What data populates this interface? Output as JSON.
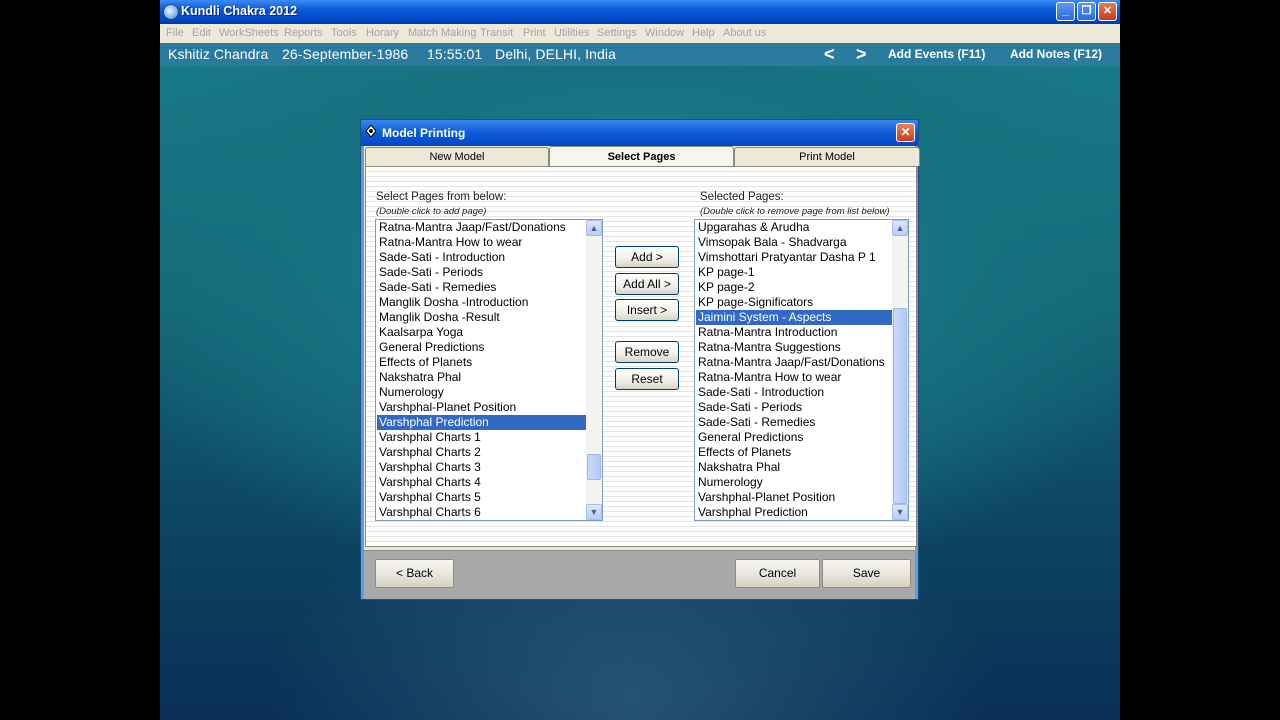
{
  "app": {
    "title": "Kundli Chakra 2012"
  },
  "window_controls": {
    "minimize": "_",
    "restore": "❐",
    "close": "✕"
  },
  "menu": [
    "File",
    "Edit",
    "WorkSheets",
    "Reports",
    "Tools",
    "Horary",
    "Match Making",
    "Transit",
    "Print",
    "Utilities",
    "Settings",
    "Window",
    "Help",
    "About us"
  ],
  "infobar": {
    "name": "Kshitiz Chandra",
    "date": "26-September-1986",
    "time": "15:55:01",
    "place": "Delhi, DELHI, India",
    "prev": "<",
    "next": ">",
    "add_events": "Add Events (F11)",
    "add_notes": "Add Notes (F12)"
  },
  "dialog": {
    "title": "Model Printing",
    "close": "✕",
    "tabs": [
      "New Model",
      "Select Pages",
      "Print Model"
    ],
    "active_tab": "Select Pages",
    "left_label": "Select Pages from below:",
    "left_hint": "(Double click to add page)",
    "right_label": "Selected Pages:",
    "right_hint": "(Double click to remove page from list below)",
    "available_pages": [
      "Ratna-Mantra Jaap/Fast/Donations",
      "Ratna-Mantra How to wear",
      "Sade-Sati - Introduction",
      "Sade-Sati - Periods",
      "Sade-Sati - Remedies",
      "Manglik Dosha -Introduction",
      "Manglik Dosha -Result",
      "Kaalsarpa Yoga",
      "General Predictions",
      "Effects of Planets",
      "Nakshatra Phal",
      "Numerology",
      "Varshphal-Planet Position",
      "Varshphal Prediction",
      "Varshphal Charts 1",
      "Varshphal Charts 2",
      "Varshphal Charts 3",
      "Varshphal Charts 4",
      "Varshphal Charts 5",
      "Varshphal Charts 6"
    ],
    "available_selected": "Varshphal Prediction",
    "selected_pages": [
      "Upgarahas & Arudha",
      "Vimsopak Bala - Shadvarga",
      "Vimshottari Pratyantar Dasha P 1",
      "KP page-1",
      "KP page-2",
      "KP page-Significators",
      "Jaimini System - Aspects",
      "Ratna-Mantra Introduction",
      "Ratna-Mantra Suggestions",
      "Ratna-Mantra Jaap/Fast/Donations",
      "Ratna-Mantra How to wear",
      "Sade-Sati - Introduction",
      "Sade-Sati - Periods",
      "Sade-Sati - Remedies",
      "General Predictions",
      "Effects of Planets",
      "Nakshatra Phal",
      "Numerology",
      "Varshphal-Planet Position",
      "Varshphal Prediction"
    ],
    "selected_selected": "Jaimini System - Aspects",
    "buttons": {
      "add": "Add >",
      "add_all": "Add All >",
      "insert": "Insert >",
      "remove": "Remove",
      "reset": "Reset",
      "back": "< Back",
      "cancel": "Cancel",
      "save": "Save"
    }
  }
}
